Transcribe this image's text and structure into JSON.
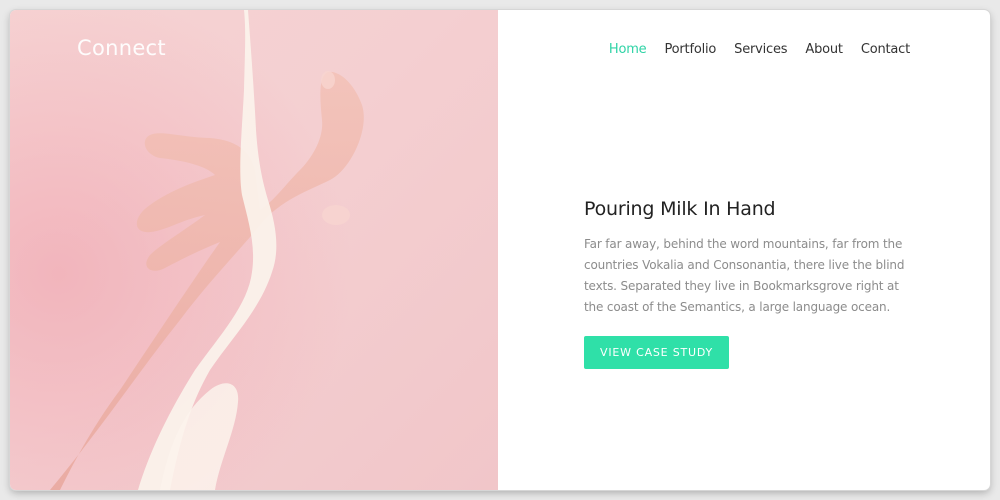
{
  "brand": {
    "logo_text": "Connect"
  },
  "nav": {
    "items": [
      {
        "label": "Home",
        "active": true
      },
      {
        "label": "Portfolio",
        "active": false
      },
      {
        "label": "Services",
        "active": false
      },
      {
        "label": "About",
        "active": false
      },
      {
        "label": "Contact",
        "active": false
      }
    ]
  },
  "hero": {
    "title": "Pouring Milk In Hand",
    "description": "Far far away, behind the word mountains, far from the countries Vokalia and Consonantia, there live the blind texts. Separated they live in Bookmarksgrove right at the coast of the Semantics, a large language ocean.",
    "cta_label": "VIEW CASE STUDY"
  },
  "colors": {
    "accent": "#2fe0a8",
    "nav_active": "#2fd3a6",
    "image_background": "#f5d0d2"
  }
}
